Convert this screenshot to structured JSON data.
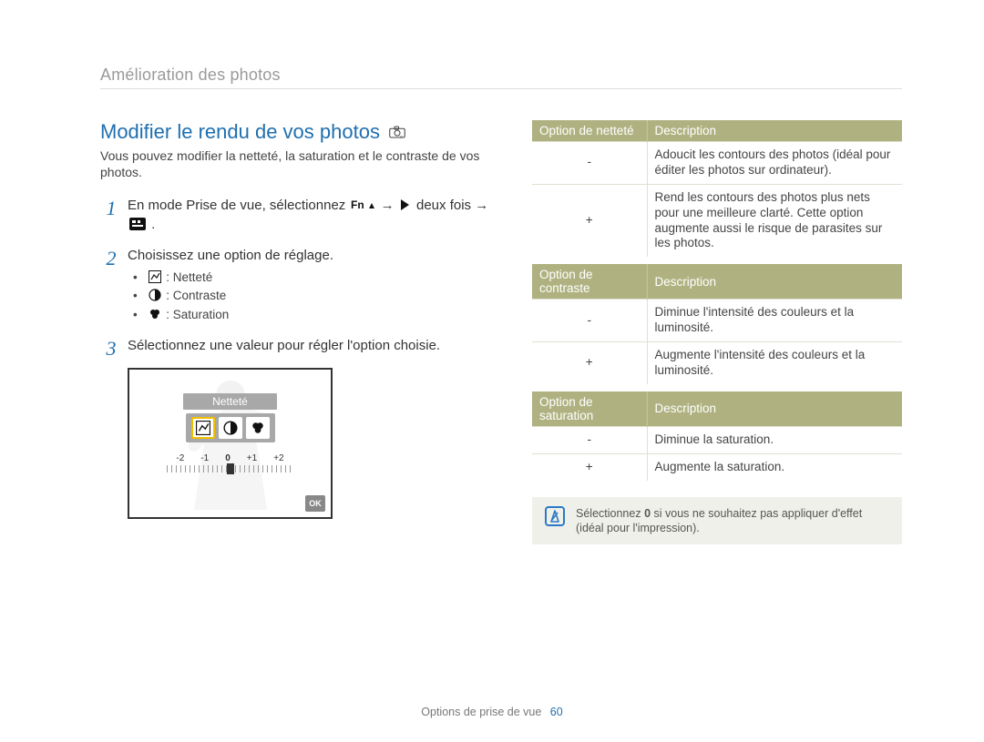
{
  "running_head": "Amélioration des photos",
  "section_title": "Modifier le rendu de vos photos",
  "intro": "Vous pouvez modifier la netteté, la saturation et le contraste de vos photos.",
  "steps": {
    "s1_pre": "En mode Prise de vue, sélectionnez ",
    "s1_arrow": " → ",
    "s1_mid": " deux fois → ",
    "s1_post": ".",
    "s2": "Choisissez une option de réglage.",
    "s2_items": {
      "sharp": " : Netteté",
      "contrast": " : Contraste",
      "saturation": " : Saturation"
    },
    "s3": "Sélectionnez une valeur pour régler l'option choisie."
  },
  "lcd": {
    "label": "Netteté",
    "scale": [
      "-2",
      "-1",
      "0",
      "+1",
      "+2"
    ],
    "ok": "OK"
  },
  "tables": {
    "sharp": {
      "h1": "Option de netteté",
      "h2": "Description",
      "rows": [
        {
          "opt": "-",
          "desc": "Adoucit les contours des photos (idéal pour éditer les photos sur ordinateur)."
        },
        {
          "opt": "+",
          "desc": "Rend les contours des photos plus nets pour une meilleure clarté. Cette option augmente aussi le risque de parasites sur les photos."
        }
      ]
    },
    "contrast": {
      "h1": "Option de contraste",
      "h2": "Description",
      "rows": [
        {
          "opt": "-",
          "desc": "Diminue l'intensité des couleurs et la luminosité."
        },
        {
          "opt": "+",
          "desc": "Augmente l'intensité des couleurs et la luminosité."
        }
      ]
    },
    "saturation": {
      "h1": "Option de saturation",
      "h2": "Description",
      "rows": [
        {
          "opt": "-",
          "desc": "Diminue la saturation."
        },
        {
          "opt": "+",
          "desc": "Augmente la saturation."
        }
      ]
    }
  },
  "note": {
    "pre": "Sélectionnez ",
    "bold": "0",
    "post": " si vous ne souhaitez pas appliquer d'effet (idéal pour l'impression)."
  },
  "footer": {
    "section": "Options de prise de vue",
    "page": "60"
  }
}
